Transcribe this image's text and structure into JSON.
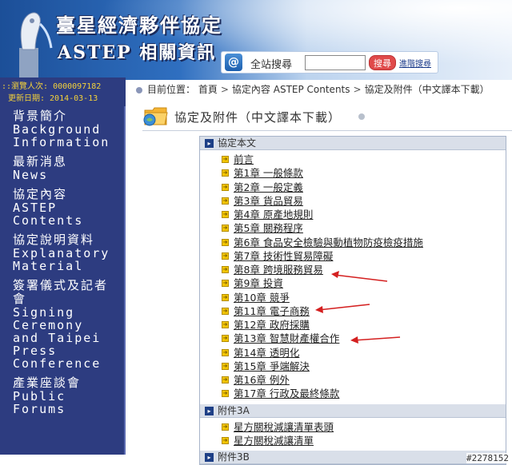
{
  "header": {
    "title_line1": "臺星經濟夥伴協定",
    "title_line2": "ASTEP  相關資訊",
    "search_label": "全站搜尋",
    "search_value": "",
    "search_button": "搜尋",
    "advanced_search": "進階搜尋"
  },
  "sidebar": {
    "visitors": "::瀏覽人次: 0000097182",
    "updated": "更新日期: 2014-03-13",
    "items": [
      {
        "zh": "背景簡介",
        "en": "Background Information"
      },
      {
        "zh": "最新消息",
        "en": "News"
      },
      {
        "zh": "協定內容",
        "en": "ASTEP Contents"
      },
      {
        "zh": "協定說明資料",
        "en": "Explanatory Material"
      },
      {
        "zh": "簽署儀式及記者會",
        "en": "Signing Ceremony and Taipei Press Conference"
      },
      {
        "zh": "產業座談會",
        "en": "Public Forums"
      }
    ]
  },
  "breadcrumb": {
    "label": "目前位置：",
    "items": [
      "首頁",
      "協定內容 ASTEP Contents",
      "協定及附件（中文譯本下載）"
    ]
  },
  "page_title": "協定及附件（中文譯本下載）",
  "sections": [
    {
      "title": "協定本文",
      "items": [
        "前言",
        "第1章 一般條款",
        "第2章 一般定義",
        "第3章 貨品貿易",
        "第4章 原產地規則",
        "第5章 關務程序",
        "第6章 食品安全檢驗與動植物防疫檢疫措施",
        "第7章 技術性貿易障礙",
        "第8章 跨境服務貿易",
        "第9章 投資",
        "第10章 競爭",
        "第11章 電子商務",
        "第12章 政府採購",
        "第13章 智慧財產權合作",
        "第14章 透明化",
        "第15章 爭端解決",
        "第16章 例外",
        "第17章 行政及最終條款"
      ]
    },
    {
      "title": "附件3A",
      "items": [
        "星方關稅減讓清單表頭",
        "星方關稅減讓清單"
      ]
    },
    {
      "title": "附件3B",
      "items": []
    }
  ],
  "watermark": "#2278152",
  "colors": {
    "sidebar": "#2d3c80",
    "stats_text": "#f4d23a",
    "annotation_arrow": "#d42020"
  }
}
